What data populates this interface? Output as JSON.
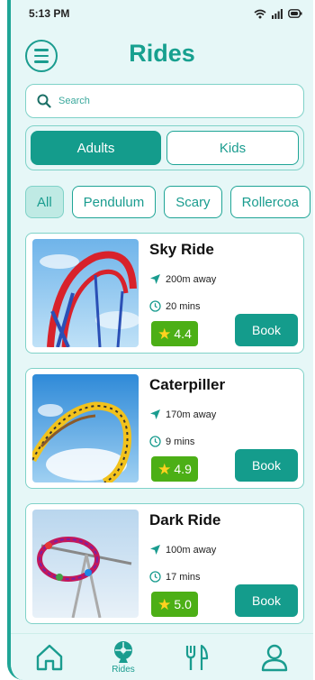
{
  "status_bar": {
    "time": "5:13 PM",
    "icons": [
      "wifi-icon",
      "signal-icon",
      "battery-icon"
    ]
  },
  "header": {
    "title": "Rides",
    "menu_icon": "menu-icon"
  },
  "search": {
    "placeholder": "Search",
    "icon": "search-icon"
  },
  "audience_tabs": [
    {
      "label": "Adults",
      "selected": true
    },
    {
      "label": "Kids",
      "selected": false
    }
  ],
  "categories": [
    {
      "label": "All",
      "selected": true
    },
    {
      "label": "Pendulum",
      "selected": false
    },
    {
      "label": "Scary",
      "selected": false
    },
    {
      "label": "Rollercoa",
      "selected": false
    }
  ],
  "rides": [
    {
      "name": "Sky Ride",
      "distance": "200m away",
      "duration": "20 mins",
      "rating": "4.4",
      "book_label": "Book"
    },
    {
      "name": "Caterpiller",
      "distance": "170m away",
      "duration": "9 mins",
      "rating": "4.9",
      "book_label": "Book"
    },
    {
      "name": "Dark Ride",
      "distance": "100m away",
      "duration": "17 mins",
      "rating": "5.0",
      "book_label": "Book"
    }
  ],
  "bottom_nav": [
    {
      "icon": "home-icon",
      "label": ""
    },
    {
      "icon": "ferris-wheel-icon",
      "label": "Rides"
    },
    {
      "icon": "fork-knife-icon",
      "label": ""
    },
    {
      "icon": "user-icon",
      "label": ""
    }
  ],
  "colors": {
    "accent": "#149c8c",
    "background": "#e6f7f7",
    "rating": "#4caf16",
    "star": "#ffd21f"
  }
}
